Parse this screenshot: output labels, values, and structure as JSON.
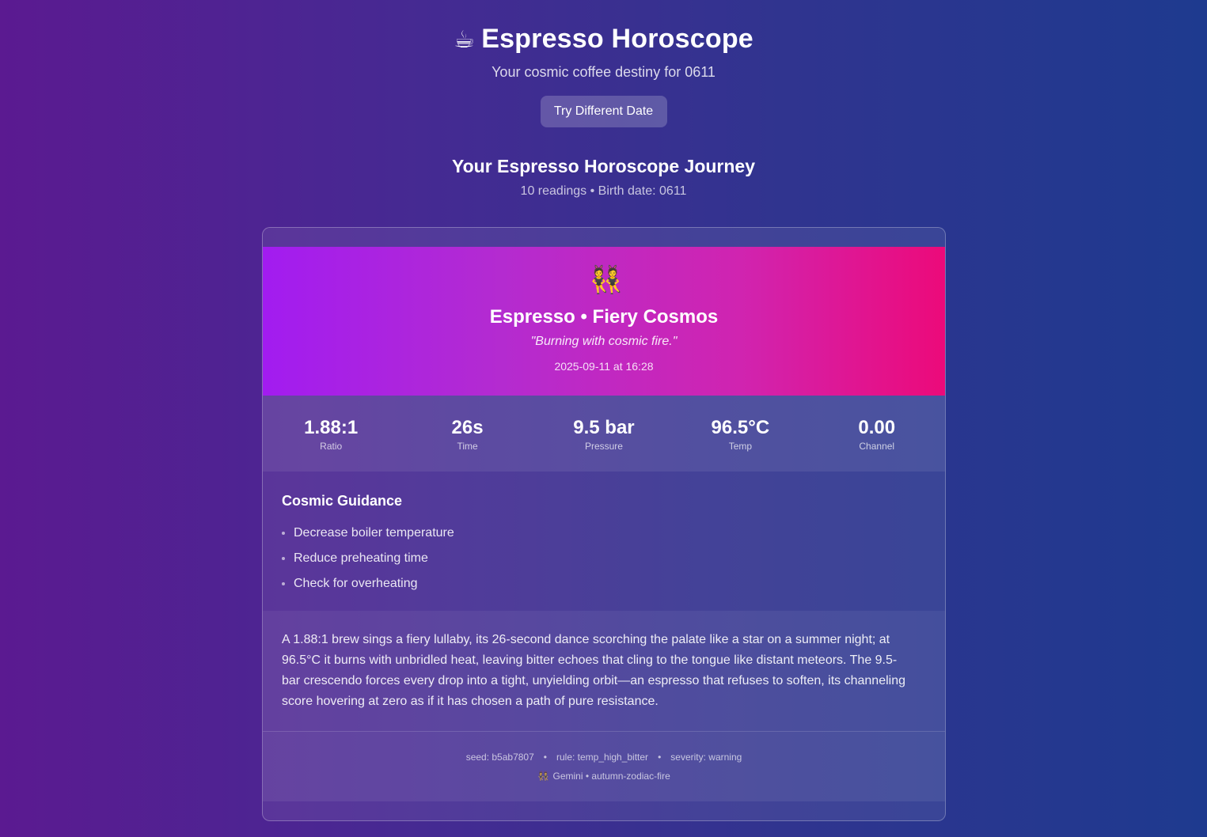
{
  "header": {
    "icon": "☕",
    "icon_name": "coffee-cup-icon",
    "title": "Espresso Horoscope",
    "subtitle": "Your cosmic coffee destiny for 0611",
    "button_label": "Try Different Date"
  },
  "journey": {
    "title": "Your Espresso Horoscope Journey",
    "meta": "10 readings • Birth date: 0611"
  },
  "reading": {
    "icon": "👯",
    "icon_name": "twins-icon",
    "title": "Espresso • Fiery Cosmos",
    "quote": "\"Burning with cosmic fire.\"",
    "date": "2025-09-11 at 16:28",
    "stats": [
      {
        "value": "1.88:1",
        "label": "Ratio"
      },
      {
        "value": "26s",
        "label": "Time"
      },
      {
        "value": "9.5 bar",
        "label": "Pressure"
      },
      {
        "value": "96.5°C",
        "label": "Temp"
      },
      {
        "value": "0.00",
        "label": "Channel"
      }
    ],
    "guidance_title": "Cosmic Guidance",
    "guidance": [
      "Decrease boiler temperature",
      "Reduce preheating time",
      "Check for overheating"
    ],
    "narrative": "A 1.88:1 brew sings a fiery lullaby, its 26-second dance scorching the palate like a star on a summer night; at 96.5°C it burns with unbridled heat, leaving bitter echoes that cling to the tongue like distant meteors. The 9.5-bar crescendo forces every drop into a tight, unyielding orbit—an espresso that refuses to soften, its channeling score hovering at zero as if it has chosen a path of pure resistance.",
    "footer": {
      "seed": "seed: b5ab7807",
      "rule": "rule: temp_high_bitter",
      "severity": "severity: warning",
      "separator": "•",
      "sign_icon": "👯",
      "sign": "Gemini • autumn-zodiac-fire"
    }
  }
}
